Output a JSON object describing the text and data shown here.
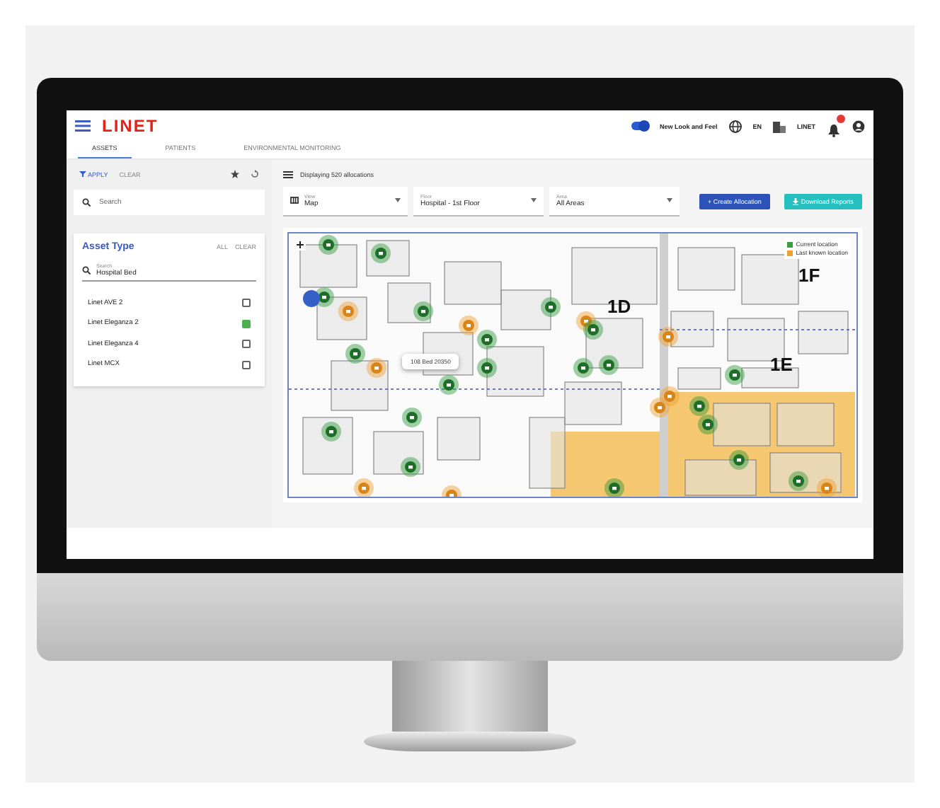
{
  "header": {
    "brand": "LINET",
    "toggle": {
      "label": "New Look and Feel",
      "on": true
    },
    "language": "EN",
    "organization": "LINET"
  },
  "tabs": [
    {
      "label": "ASSETS",
      "selected": true
    },
    {
      "label": "PATIENTS",
      "selected": false
    },
    {
      "label": "ENVIRONMENTAL MONITORING",
      "selected": false
    }
  ],
  "filter_bar": {
    "apply": "APPLY",
    "clear": "CLEAR"
  },
  "search": {
    "placeholder": "Search"
  },
  "asset_type": {
    "title": "Asset Type",
    "all": "ALL",
    "clear": "CLEAR",
    "search": {
      "label": "Search",
      "value": "Hospital Bed"
    },
    "items": [
      {
        "label": "Linet AVE 2",
        "checked": false
      },
      {
        "label": "Linet Eleganza 2",
        "checked": true
      },
      {
        "label": "Linet Eleganza 4",
        "checked": false
      },
      {
        "label": "Linet MCX",
        "checked": false
      }
    ]
  },
  "allocations": "Displaying 520 allocations",
  "selects": [
    {
      "label": "View",
      "value": "Map"
    },
    {
      "label": "Floor",
      "value": "Hospital - 1st Floor"
    },
    {
      "label": "Area",
      "value": "All Areas"
    }
  ],
  "buttons": [
    {
      "kind": "create",
      "label": "+ Create Allocation"
    },
    {
      "kind": "download",
      "label": "Download Reports"
    }
  ],
  "map": {
    "zones": [
      "1D",
      "1E",
      "1F"
    ],
    "tooltip": "108 Bed 20350",
    "legend": [
      {
        "label": "Current location",
        "color": "#3a9c3e"
      },
      {
        "label": "Last known location",
        "color": "#f0a030"
      }
    ]
  }
}
